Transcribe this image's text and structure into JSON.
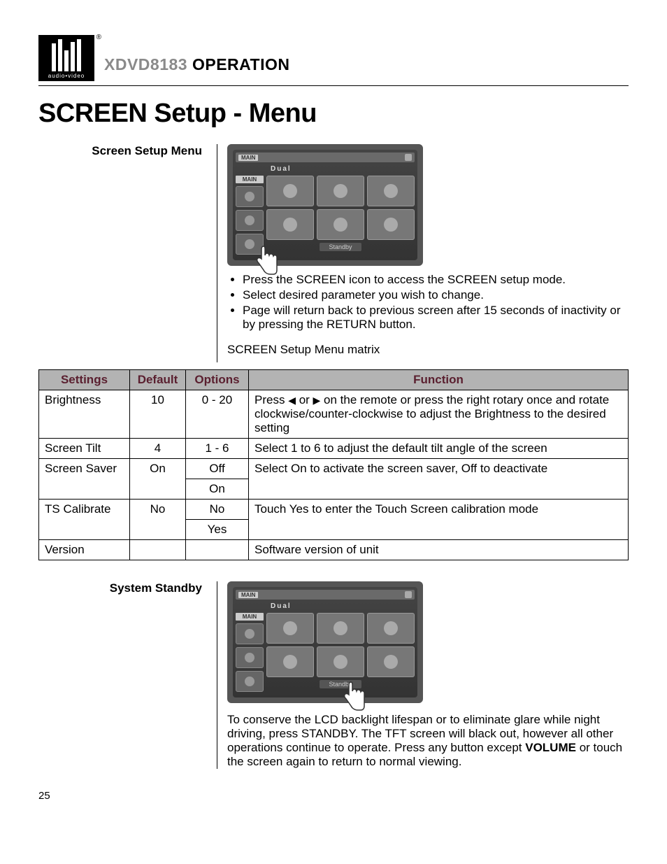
{
  "logo": {
    "sublabel": "audio•video",
    "reg": "®"
  },
  "header": {
    "model": "XDVD8183",
    "word": "OPERATION"
  },
  "title": "SCREEN Setup - Menu",
  "section1": {
    "label": "Screen Setup Menu",
    "dev": {
      "main": "MAIN",
      "brand": "Dual",
      "standby": "Standby"
    },
    "bullets": [
      "Press the SCREEN icon to access the SCREEN setup mode.",
      "Select desired parameter you wish to change.",
      "Page will return back to previous screen after 15 seconds of inactivity or by pressing the RETURN button."
    ],
    "matrix_caption": "SCREEN Setup Menu matrix"
  },
  "table": {
    "headers": [
      "Settings",
      "Default",
      "Options",
      "Function"
    ],
    "rows": {
      "brightness": {
        "setting": "Brightness",
        "def": "10",
        "options": "0 - 20",
        "func_pre": "Press ",
        "func_mid": " or ",
        "func_post": " on the remote or press the right rotary once and rotate clockwise/counter-clockwise to adjust the Brightness to the desired setting"
      },
      "tilt": {
        "setting": "Screen Tilt",
        "def": "4",
        "options": "1 - 6",
        "func": "Select 1 to 6 to adjust the default tilt angle of the screen"
      },
      "saver": {
        "setting": "Screen Saver",
        "def": "On",
        "opt1": "Off",
        "opt2": "On",
        "func": "Select On to activate the screen saver, Off to deactivate"
      },
      "ts": {
        "setting": "TS Calibrate",
        "def": "No",
        "opt1": "No",
        "opt2": "Yes",
        "func": "Touch Yes to enter the Touch Screen calibration mode"
      },
      "version": {
        "setting": "Version",
        "def": "",
        "options": "",
        "func": "Software version of unit"
      }
    }
  },
  "section2": {
    "label": "System Standby",
    "dev": {
      "main": "MAIN",
      "brand": "Dual",
      "standby": "Standby"
    },
    "para_pre": "To conserve the LCD backlight lifespan or to eliminate glare while night driving, press STANDBY. The TFT screen will black out, however all other operations continue to operate. Press any button except ",
    "para_bold": "VOLUME",
    "para_post": " or touch the screen again to return to normal viewing."
  },
  "pagenum": "25"
}
